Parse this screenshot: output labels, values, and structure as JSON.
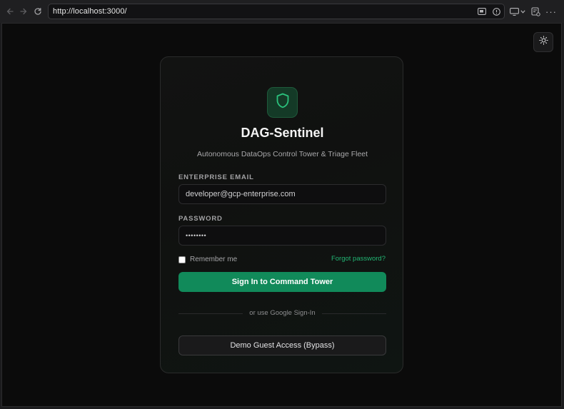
{
  "browser": {
    "url": "http://localhost:3000/",
    "icons": [
      "back-arrow-icon",
      "forward-arrow-icon",
      "reload-icon",
      "picture-in-picture-icon",
      "info-icon",
      "cast-icon",
      "chevron-down-icon",
      "extensions-icon",
      "more-icon"
    ]
  },
  "theme_toggle": {
    "icon": "sun-icon"
  },
  "login": {
    "logo_icon": "shield-icon",
    "title": "DAG-Sentinel",
    "subtitle": "Autonomous DataOps Control Tower & Triage Fleet",
    "email_label": "ENTERPRISE EMAIL",
    "email_value": "developer@gcp-enterprise.com",
    "password_label": "PASSWORD",
    "password_value": "••••••••",
    "remember_label": "Remember me",
    "remember_checked": false,
    "forgot_label": "Forgot password?",
    "sign_in_label": "Sign In to Command Tower",
    "divider_text": "or use Google Sign-In",
    "guest_label": "Demo Guest Access (Bypass)"
  },
  "colors": {
    "accent": "#118a5a",
    "link": "#22b573",
    "background": "#0b0b0b",
    "card": "#121312"
  }
}
